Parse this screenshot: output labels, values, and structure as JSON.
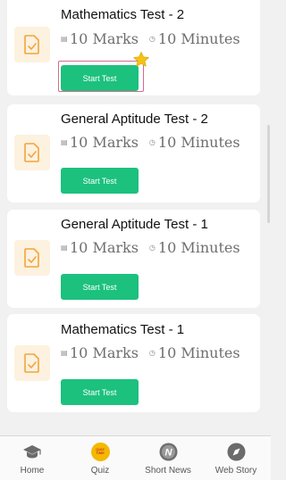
{
  "cards": [
    {
      "title": "Mathematics Test - 2",
      "marks": "10 Marks",
      "minutes": "10 Minutes",
      "button": "Start Test"
    },
    {
      "title": "General Aptitude Test - 2",
      "marks": "10 Marks",
      "minutes": "10 Minutes",
      "button": "Start Test"
    },
    {
      "title": "General Aptitude Test - 1",
      "marks": "10 Marks",
      "minutes": "10 Minutes",
      "button": "Start Test"
    },
    {
      "title": "Mathematics Test - 1",
      "marks": "10 Marks",
      "minutes": "10 Minutes",
      "button": "Start Test"
    }
  ],
  "nav": {
    "home": "Home",
    "quiz": "Quiz",
    "quiz_badge": "QUIZ TIME",
    "short_news": "Short News",
    "web_story": "Web Story"
  },
  "colors": {
    "accent": "#1cc17e",
    "icon_bg": "#fdf1df",
    "icon_stroke": "#f2a63d",
    "highlight": "#d46a8d",
    "star": "#f5c218"
  }
}
